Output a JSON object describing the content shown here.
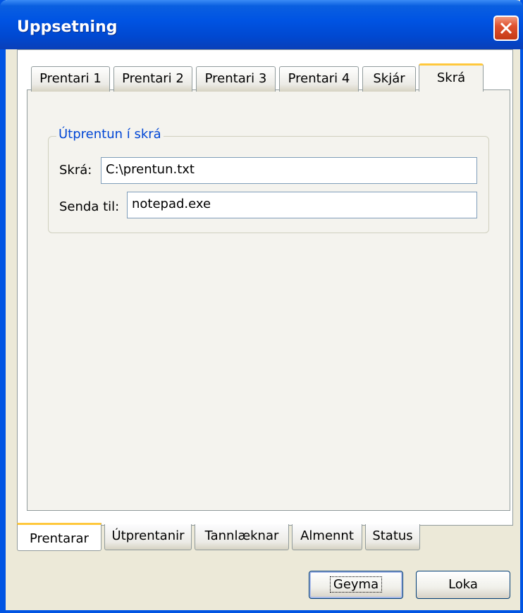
{
  "window": {
    "title": "Uppsetning"
  },
  "top_tabs": [
    {
      "label": "Prentari 1"
    },
    {
      "label": "Prentari 2"
    },
    {
      "label": "Prentari 3"
    },
    {
      "label": "Prentari 4"
    },
    {
      "label": "Skjár"
    },
    {
      "label": "Skrá",
      "active": true
    }
  ],
  "group": {
    "title": "Útprentun í skrá",
    "file_label": "Skrá:",
    "file_value": "C:\\prentun.txt",
    "send_label": "Senda til:",
    "send_value": "notepad.exe"
  },
  "bottom_tabs": [
    {
      "label": "Prentarar",
      "active": true
    },
    {
      "label": "Útprentanir"
    },
    {
      "label": "Tannlæknar"
    },
    {
      "label": "Almennt"
    },
    {
      "label": "Status"
    }
  ],
  "buttons": {
    "save": "Geyma",
    "close": "Loka"
  },
  "colors": {
    "titlebar": "#0054e3",
    "tab_highlight": "#ffc83c",
    "group_title": "#0046d5"
  }
}
